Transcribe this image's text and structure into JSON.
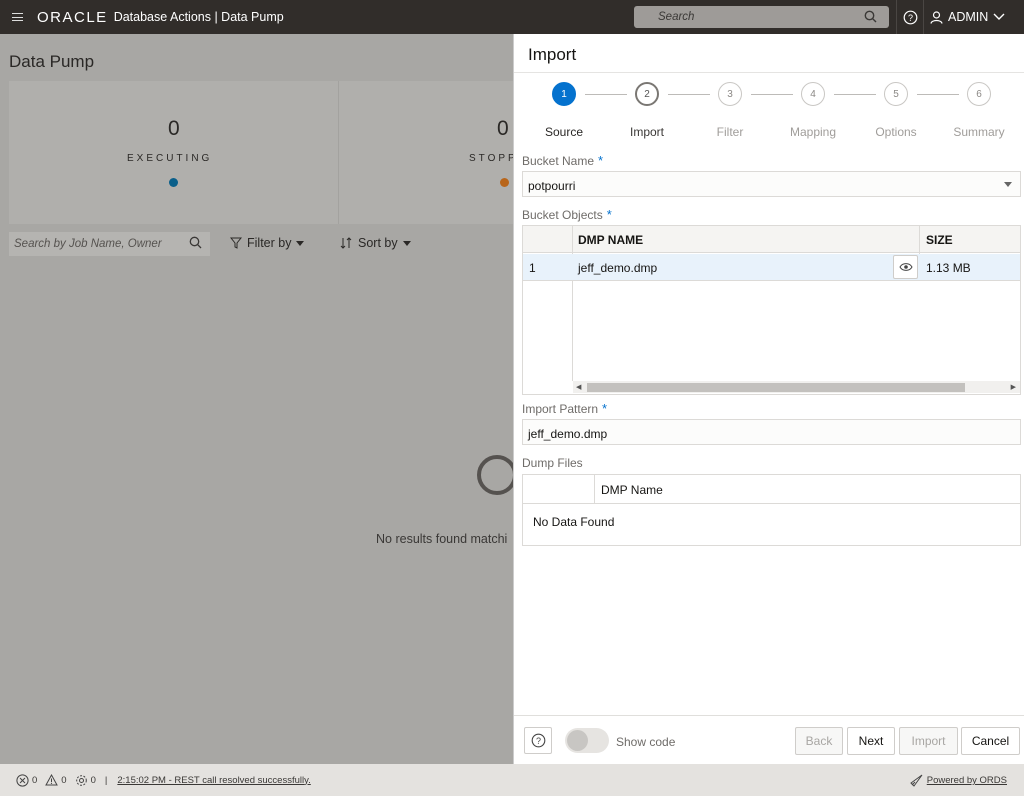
{
  "topbar": {
    "brand": "ORACLE",
    "app_title": "Database Actions | Data Pump",
    "search_placeholder": "Search",
    "user": "ADMIN"
  },
  "page": {
    "title": "Data Pump",
    "cards": [
      {
        "count": "0",
        "label": "EXECUTING",
        "dot_color": "#0a5f8a"
      },
      {
        "count": "0",
        "label": "STOPPED",
        "dot_color": "#b8651a"
      }
    ],
    "search_placeholder": "Search by Job Name, Owner",
    "filter_label": "Filter by",
    "sort_label": "Sort by",
    "no_results": "No results found matchi"
  },
  "drawer": {
    "title": "Import",
    "steps": [
      {
        "num": "1",
        "label": "Source"
      },
      {
        "num": "2",
        "label": "Import"
      },
      {
        "num": "3",
        "label": "Filter"
      },
      {
        "num": "4",
        "label": "Mapping"
      },
      {
        "num": "5",
        "label": "Options"
      },
      {
        "num": "6",
        "label": "Summary"
      }
    ],
    "bucket_name_label": "Bucket Name",
    "bucket_name_value": "potpourri",
    "bucket_objects_label": "Bucket Objects",
    "objects_table": {
      "headers": [
        "DMP NAME",
        "SIZE"
      ],
      "rows": [
        {
          "index": "1",
          "name": "jeff_demo.dmp",
          "size": "1.13 MB"
        }
      ]
    },
    "import_pattern_label": "Import Pattern",
    "import_pattern_value": "jeff_demo.dmp",
    "dump_files_label": "Dump Files",
    "dump_table_header": "DMP Name",
    "dump_no_data": "No Data Found",
    "required_mark": "*",
    "footer": {
      "show_code_label": "Show code",
      "back_label": "Back",
      "next_label": "Next",
      "import_label": "Import",
      "cancel_label": "Cancel"
    }
  },
  "statusbar": {
    "error_count": "0",
    "warning_count": "0",
    "process_count": "0",
    "message": "2:15:02 PM - REST call resolved successfully.",
    "powered": "Powered by ORDS"
  }
}
